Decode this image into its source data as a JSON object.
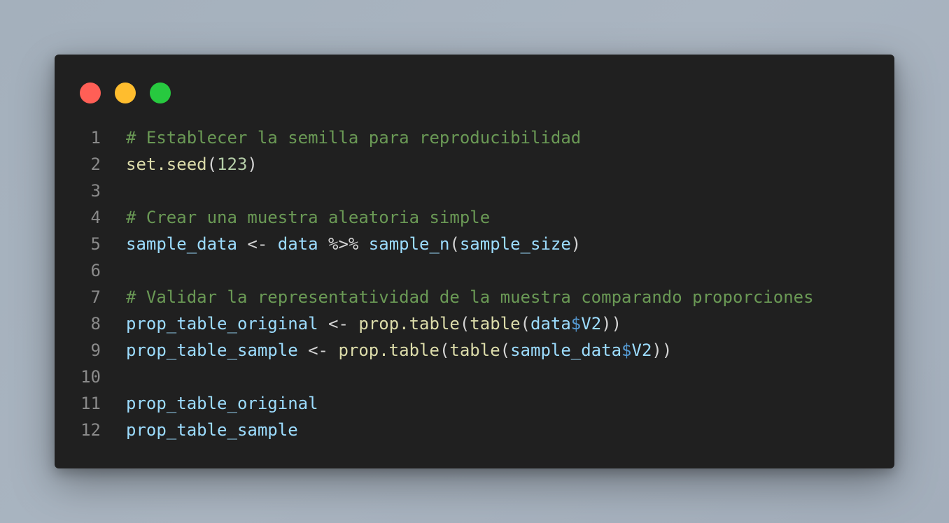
{
  "window": {
    "traffic_lights": [
      {
        "name": "close",
        "color": "#ff5f56"
      },
      {
        "name": "minimize",
        "color": "#ffbd2e"
      },
      {
        "name": "zoom",
        "color": "#27c93f"
      }
    ]
  },
  "code": {
    "language": "R",
    "lines": [
      {
        "number": "1",
        "tokens": [
          {
            "type": "comment",
            "text": "# Establecer la semilla para reproducibilidad"
          }
        ]
      },
      {
        "number": "2",
        "tokens": [
          {
            "type": "fn",
            "text": "set.seed"
          },
          {
            "type": "punct",
            "text": "("
          },
          {
            "type": "num",
            "text": "123"
          },
          {
            "type": "punct",
            "text": ")"
          }
        ]
      },
      {
        "number": "3",
        "tokens": []
      },
      {
        "number": "4",
        "tokens": [
          {
            "type": "comment",
            "text": "# Crear una muestra aleatoria simple"
          }
        ]
      },
      {
        "number": "5",
        "tokens": [
          {
            "type": "var",
            "text": "sample_data"
          },
          {
            "type": "op",
            "text": " <- "
          },
          {
            "type": "var",
            "text": "data"
          },
          {
            "type": "op",
            "text": " %>% "
          },
          {
            "type": "var",
            "text": "sample_n"
          },
          {
            "type": "punct",
            "text": "("
          },
          {
            "type": "var",
            "text": "sample_size"
          },
          {
            "type": "punct",
            "text": ")"
          }
        ]
      },
      {
        "number": "6",
        "tokens": []
      },
      {
        "number": "7",
        "tokens": [
          {
            "type": "comment",
            "text": "# Validar la representatividad de la muestra comparando proporciones"
          }
        ]
      },
      {
        "number": "8",
        "tokens": [
          {
            "type": "var",
            "text": "prop_table_original"
          },
          {
            "type": "op",
            "text": " <- "
          },
          {
            "type": "fn",
            "text": "prop.table"
          },
          {
            "type": "punct",
            "text": "("
          },
          {
            "type": "fn",
            "text": "table"
          },
          {
            "type": "punct",
            "text": "("
          },
          {
            "type": "var",
            "text": "data"
          },
          {
            "type": "dollar",
            "text": "$"
          },
          {
            "type": "var",
            "text": "V2"
          },
          {
            "type": "punct",
            "text": "))"
          }
        ]
      },
      {
        "number": "9",
        "tokens": [
          {
            "type": "var",
            "text": "prop_table_sample"
          },
          {
            "type": "op",
            "text": " <- "
          },
          {
            "type": "fn",
            "text": "prop.table"
          },
          {
            "type": "punct",
            "text": "("
          },
          {
            "type": "fn",
            "text": "table"
          },
          {
            "type": "punct",
            "text": "("
          },
          {
            "type": "var",
            "text": "sample_data"
          },
          {
            "type": "dollar",
            "text": "$"
          },
          {
            "type": "var",
            "text": "V2"
          },
          {
            "type": "punct",
            "text": "))"
          }
        ]
      },
      {
        "number": "10",
        "tokens": []
      },
      {
        "number": "11",
        "tokens": [
          {
            "type": "var",
            "text": "prop_table_original"
          }
        ]
      },
      {
        "number": "12",
        "tokens": [
          {
            "type": "var",
            "text": "prop_table_sample"
          }
        ]
      }
    ]
  }
}
